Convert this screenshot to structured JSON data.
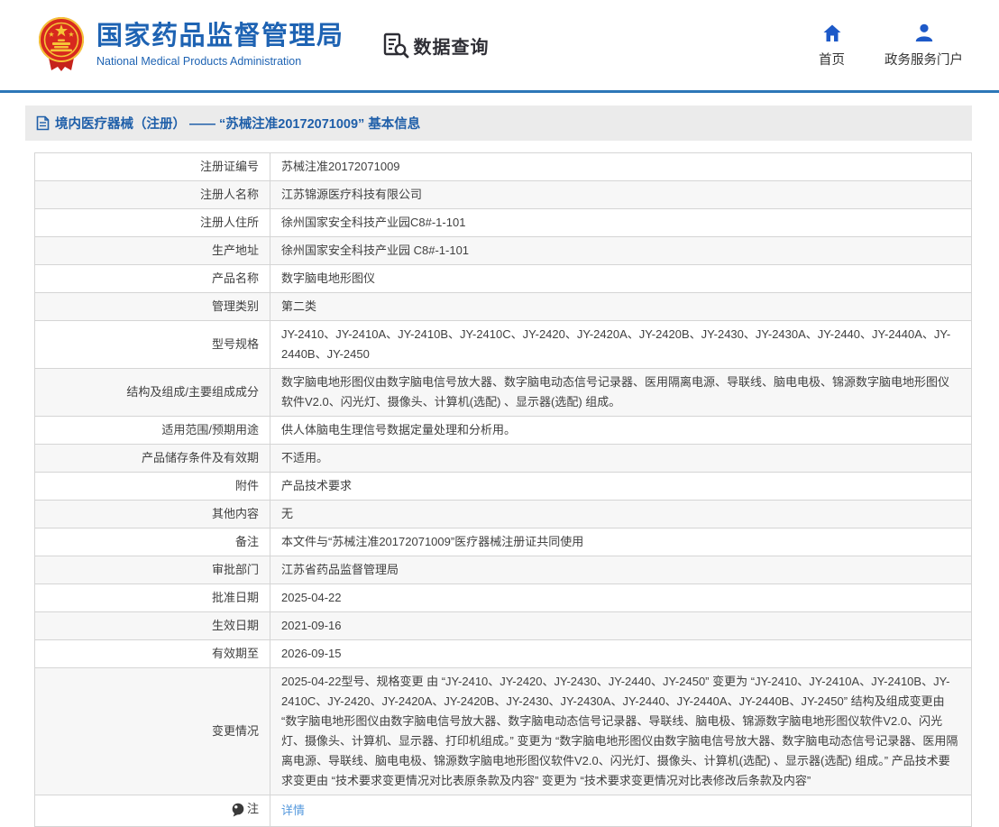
{
  "header": {
    "org_name_zh": "国家药品监督管理局",
    "org_name_en": "National Medical Products Administration",
    "data_query_label": "数据查询",
    "nav": [
      {
        "label": "首页",
        "icon": "home-icon"
      },
      {
        "label": "政务服务门户",
        "icon": "user-icon"
      }
    ]
  },
  "breadcrumb": {
    "text": "境内医疗器械（注册） —— “苏械注准20172071009” 基本信息"
  },
  "table": {
    "rows": [
      {
        "label": "注册证编号",
        "value": "苏械注准20172071009"
      },
      {
        "label": "注册人名称",
        "value": "江苏锦源医疗科技有限公司"
      },
      {
        "label": "注册人住所",
        "value": "徐州国家安全科技产业园C8#-1-101"
      },
      {
        "label": "生产地址",
        "value": "徐州国家安全科技产业园 C8#-1-101"
      },
      {
        "label": "产品名称",
        "value": "数字脑电地形图仪"
      },
      {
        "label": "管理类别",
        "value": "第二类"
      },
      {
        "label": "型号规格",
        "value": "JY-2410、JY-2410A、JY-2410B、JY-2410C、JY-2420、JY-2420A、JY-2420B、JY-2430、JY-2430A、JY-2440、JY-2440A、JY-2440B、JY-2450"
      },
      {
        "label": "结构及组成/主要组成成分",
        "value": "数字脑电地形图仪由数字脑电信号放大器、数字脑电动态信号记录器、医用隔离电源、导联线、脑电电极、锦源数字脑电地形图仪软件V2.0、闪光灯、摄像头、计算机(选配) 、显示器(选配) 组成。"
      },
      {
        "label": "适用范围/预期用途",
        "value": "供人体脑电生理信号数据定量处理和分析用。"
      },
      {
        "label": "产品储存条件及有效期",
        "value": "不适用。"
      },
      {
        "label": "附件",
        "value": "产品技术要求"
      },
      {
        "label": "其他内容",
        "value": "无"
      },
      {
        "label": "备注",
        "value": "本文件与“苏械注准20172071009”医疗器械注册证共同使用"
      },
      {
        "label": "审批部门",
        "value": "江苏省药品监督管理局"
      },
      {
        "label": "批准日期",
        "value": "2025-04-22"
      },
      {
        "label": "生效日期",
        "value": "2021-09-16"
      },
      {
        "label": "有效期至",
        "value": "2026-09-15"
      },
      {
        "label": "变更情况",
        "value": "2025-04-22型号、规格变更 由 “JY-2410、JY-2420、JY-2430、JY-2440、JY-2450” 变更为 “JY-2410、JY-2410A、JY-2410B、JY-2410C、JY-2420、JY-2420A、JY-2420B、JY-2430、JY-2430A、JY-2440、JY-2440A、JY-2440B、JY-2450” 结构及组成变更由 “数字脑电地形图仪由数字脑电信号放大器、数字脑电动态信号记录器、导联线、脑电极、锦源数字脑电地形图仪软件V2.0、闪光灯、摄像头、计算机、显示器、打印机组成。” 变更为 “数字脑电地形图仪由数字脑电信号放大器、数字脑电动态信号记录器、医用隔离电源、导联线、脑电电极、锦源数字脑电地形图仪软件V2.0、闪光灯、摄像头、计算机(选配) 、显示器(选配) 组成。” 产品技术要求变更由 “技术要求变更情况对比表原条款及内容” 变更为 “技术要求变更情况对比表修改后条款及内容”"
      },
      {
        "label": "注",
        "value": "详情"
      }
    ]
  },
  "colors": {
    "brand_blue": "#1e63b3",
    "nav_icon_blue": "#1d59c8",
    "breadcrumb_blue": "#1f5fa9",
    "link_blue": "#5599dd",
    "divider_blue": "#2d77b8",
    "emblem_red": "#d7281e",
    "emblem_gold": "#f5c437",
    "alt_row_bg": "#f7f7f7"
  }
}
